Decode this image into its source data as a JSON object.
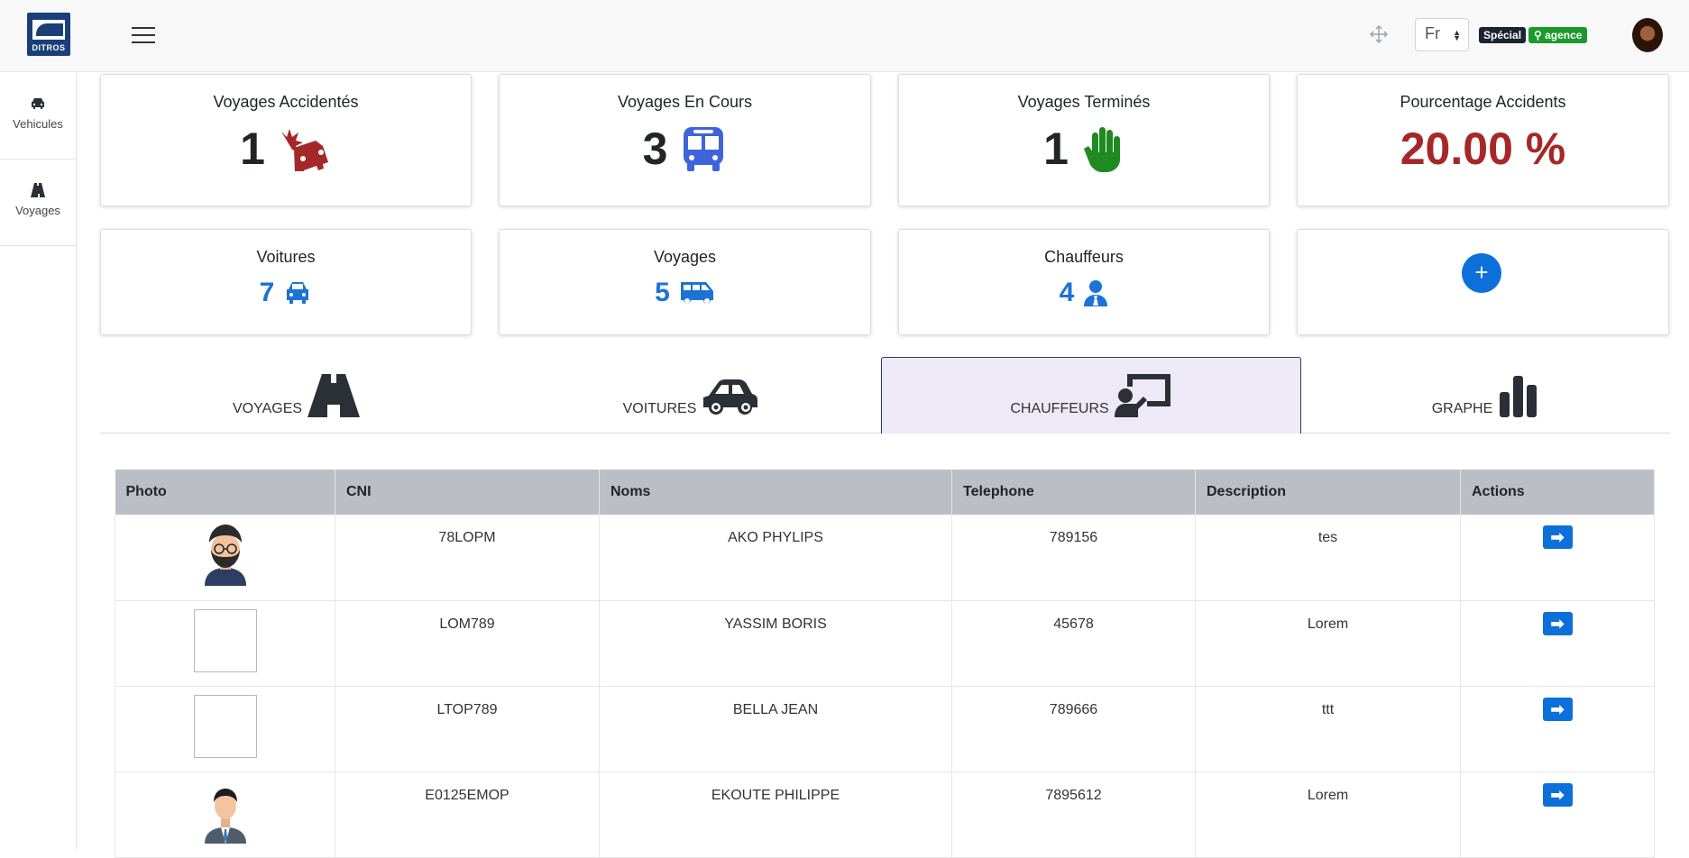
{
  "header": {
    "logo_text": "DITROS",
    "language": "Fr",
    "badge_special": "Spécial",
    "badge_agence": "agence"
  },
  "sidebar": {
    "items": [
      {
        "label": "Vehicules",
        "icon": "car-icon"
      },
      {
        "label": "Voyages",
        "icon": "road-icon"
      }
    ]
  },
  "stats_top": [
    {
      "title": "Voyages Accidentés",
      "value": "1",
      "icon": "car-crash-icon",
      "color": "#a52828"
    },
    {
      "title": "Voyages En Cours",
      "value": "3",
      "icon": "bus-icon",
      "color": "#3f63d8"
    },
    {
      "title": "Voyages Terminés",
      "value": "1",
      "icon": "hand-icon",
      "color": "#1f8a1f"
    },
    {
      "title": "Pourcentage Accidents",
      "value": "20.00 %",
      "color": "#a52828"
    }
  ],
  "stats_bottom": [
    {
      "title": "Voitures",
      "value": "7",
      "icon": "car-icon"
    },
    {
      "title": "Voyages",
      "value": "5",
      "icon": "shuttle-van-icon"
    },
    {
      "title": "Chauffeurs",
      "value": "4",
      "icon": "user-tie-icon"
    }
  ],
  "add_button": "+",
  "tabs": [
    {
      "label": "VOYAGES",
      "icon": "road-icon"
    },
    {
      "label": "VOITURES",
      "icon": "car-side-icon"
    },
    {
      "label": "CHAUFFEURS",
      "icon": "chalkboard-teacher-icon",
      "active": true
    },
    {
      "label": "GRAPHE",
      "icon": "bar-chart-icon"
    }
  ],
  "table": {
    "columns": [
      "Photo",
      "CNI",
      "Noms",
      "Telephone",
      "Description",
      "Actions"
    ],
    "rows": [
      {
        "photo": "avatar-bearded",
        "cni": "78LOPM",
        "nom": "AKO PHYLIPS",
        "tel": "789156",
        "desc": "tes",
        "action": "➡"
      },
      {
        "photo": "broken",
        "cni": "LOM789",
        "nom": "YASSIM BORIS",
        "tel": "45678",
        "desc": "Lorem",
        "action": "➡"
      },
      {
        "photo": "broken",
        "cni": "LTOP789",
        "nom": "BELLA JEAN",
        "tel": "789666",
        "desc": "ttt",
        "action": "➡"
      },
      {
        "photo": "avatar-suit",
        "cni": "E0125EMOP",
        "nom": "EKOUTE PHILIPPE",
        "tel": "7895612",
        "desc": "Lorem",
        "action": "➡"
      }
    ]
  }
}
